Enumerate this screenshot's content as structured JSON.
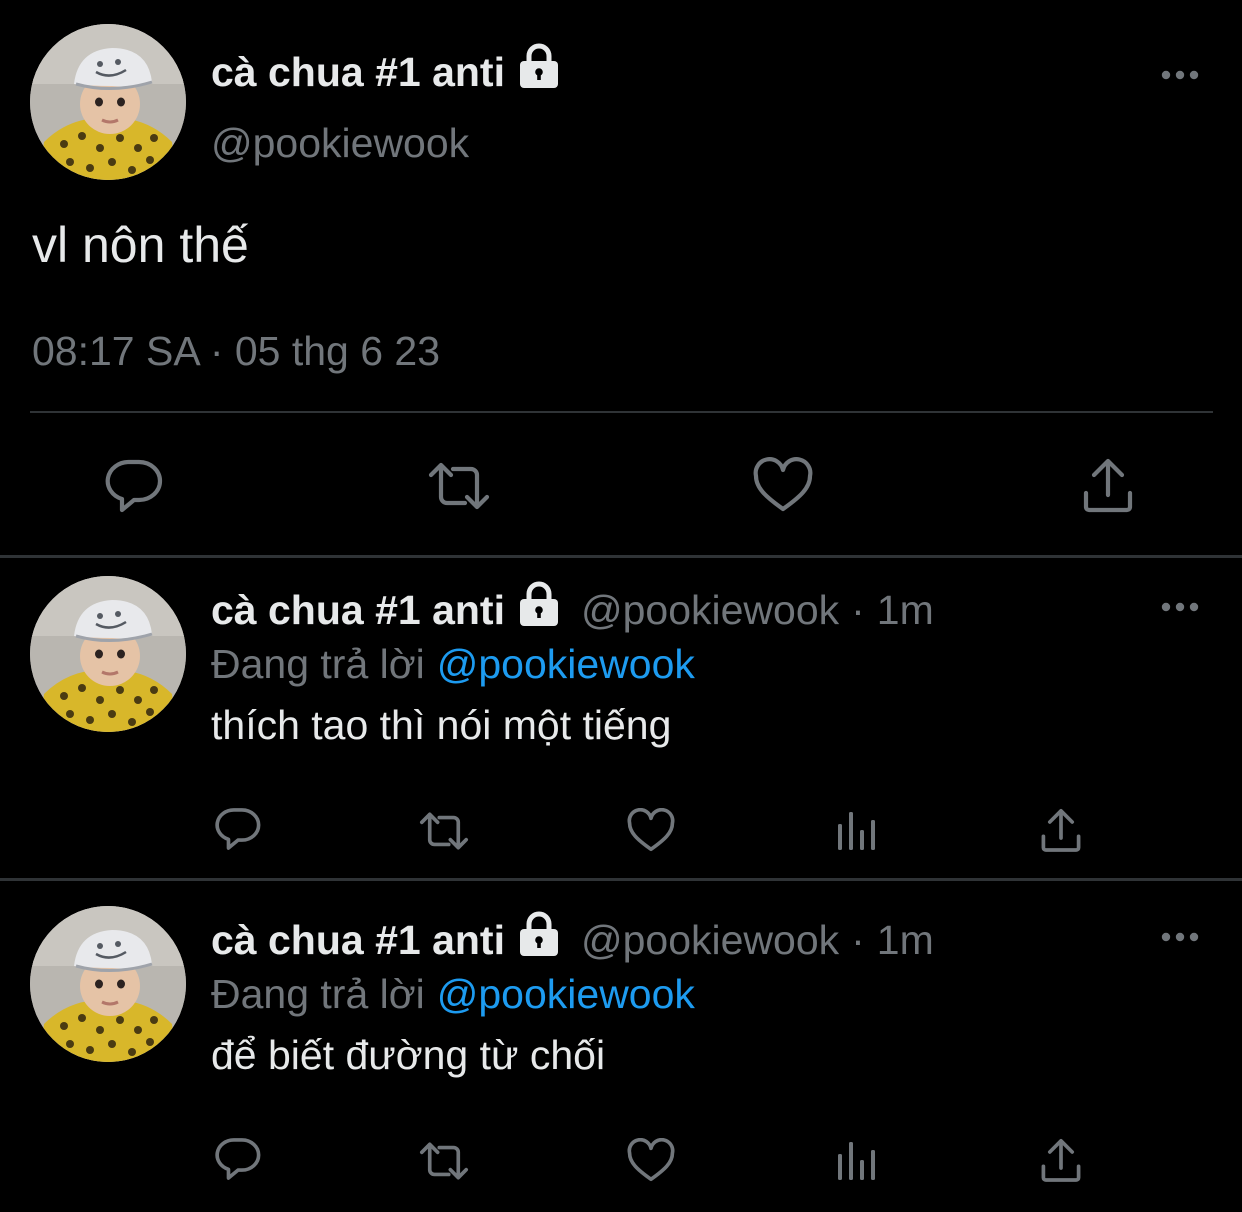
{
  "colors": {
    "background": "#000000",
    "text_primary": "#e7e9ea",
    "text_secondary": "#71767b",
    "link": "#1d9bf0",
    "divider": "#2f3336"
  },
  "main_tweet": {
    "display_name": "cà chua #1 anti",
    "handle": "@pookiewook",
    "text": "vl nôn thế",
    "meta": "08:17 SA · 05 thg 6 23",
    "icons": [
      "lock-icon",
      "more-icon",
      "reply-icon",
      "retweet-icon",
      "like-icon",
      "share-icon"
    ]
  },
  "replies": [
    {
      "display_name": "cà chua #1 anti",
      "handle": "@pookiewook",
      "separator": "·",
      "time": "1m",
      "replying_prefix": "Đang trả lời",
      "replying_to": "@pookiewook",
      "text": "thích tao thì nói một tiếng",
      "icons": [
        "reply-icon",
        "retweet-icon",
        "like-icon",
        "analytics-icon",
        "share-icon"
      ]
    },
    {
      "display_name": "cà chua #1 anti",
      "handle": "@pookiewook",
      "separator": "·",
      "time": "1m",
      "replying_prefix": "Đang trả lời",
      "replying_to": "@pookiewook",
      "text": "để biết đường từ chối",
      "icons": [
        "reply-icon",
        "retweet-icon",
        "like-icon",
        "analytics-icon",
        "share-icon"
      ]
    }
  ]
}
